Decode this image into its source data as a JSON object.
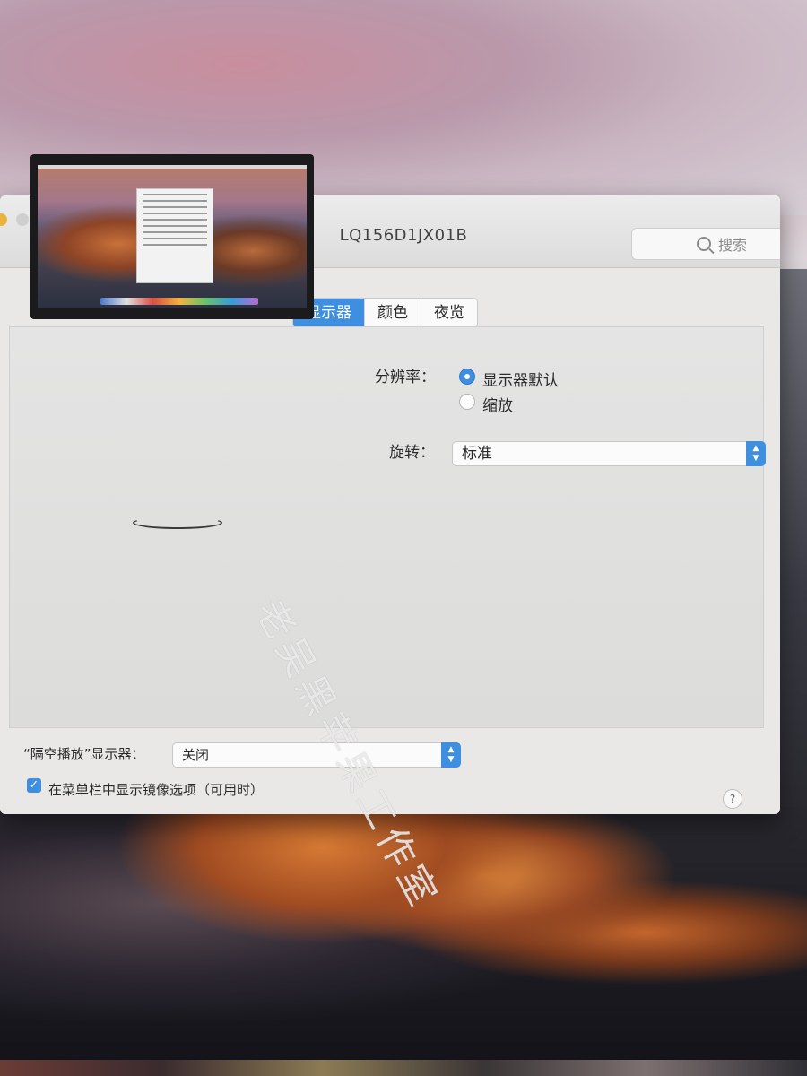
{
  "window": {
    "title": "LQ156D1JX01B",
    "search_placeholder": "搜索"
  },
  "toolbar": {
    "back_icon": "‹",
    "forward_icon": "›"
  },
  "tabs": [
    {
      "label": "显示器",
      "active": true
    },
    {
      "label": "颜色",
      "active": false
    },
    {
      "label": "夜览",
      "active": false
    }
  ],
  "resolution": {
    "label": "分辨率：",
    "options": [
      {
        "label": "显示器默认",
        "selected": true
      },
      {
        "label": "缩放",
        "selected": false
      }
    ]
  },
  "rotation": {
    "label": "旋转：",
    "value": "标准"
  },
  "airplay": {
    "label": "“隔空播放”显示器：",
    "value": "关闭"
  },
  "mirroring_option": {
    "label": "在菜单栏中显示镜像选项（可用时）",
    "checked": true
  },
  "help_label": "?",
  "watermark": "老吴黑苹果工作室",
  "colors": {
    "accent": "#3f8fe0",
    "window_bg": "#e9e8e6"
  },
  "icons": [
    "back-chevron-icon",
    "forward-chevron-icon",
    "grid-icon",
    "search-icon",
    "stepper-icon",
    "checkmark-icon",
    "help-icon"
  ]
}
